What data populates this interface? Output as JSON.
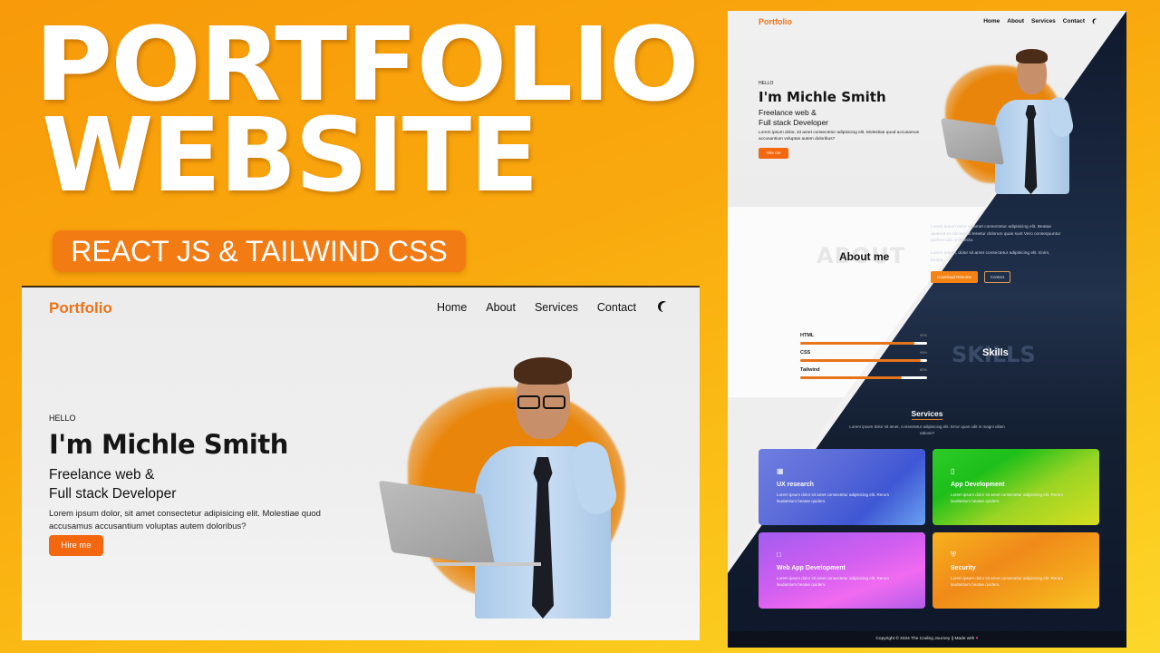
{
  "headline": {
    "line1": "PORTFOLIO",
    "line2": "WEBSITE"
  },
  "badge": "REACT JS & TAILWIND CSS",
  "colors": {
    "accent": "#f3680f",
    "brand": "#ec7319",
    "dark": "#0f172a",
    "background": "#f9a90d"
  },
  "site": {
    "logo": "Portfolio",
    "nav": [
      "Home",
      "About",
      "Services",
      "Contact"
    ],
    "theme_icon": "moon-icon",
    "hero": {
      "greeting": "HELLO",
      "name": "I'm Michle Smith",
      "role_line1": "Freelance web &",
      "role_line2": "Full stack Developer",
      "description": "Lorem ipsum dolor, sit amet consectetur adipisicing elit. Molestiae quod accusamus accusantium voluptas autem doloribus?",
      "cta": "Hire me"
    },
    "about": {
      "bg_word": "ABOUT",
      "title": "About me",
      "paragraph1": "Lorem ipsum dolor sit amet consectetur adipisicing elit. Beatae quaerat ex obcaecati tenetur dolorum quas sunt Vero consequuntur perferendis architecto.",
      "paragraph2": "Lorem ipsum, dolor sit amet consectetur adipisicing elit. Enim, beatae.",
      "download_label": "Download Resume",
      "contact_label": "Contact"
    },
    "skills": {
      "bg_word": "SKILLS",
      "title": "Skills",
      "items": [
        {
          "name": "HTML",
          "percent": 90
        },
        {
          "name": "CSS",
          "percent": 95
        },
        {
          "name": "Tailwind",
          "percent": 80
        }
      ]
    },
    "services": {
      "title": "Services",
      "description": "Lorem ipsum dolor sit amet, consectetur adipisicing elit. Error quas odit in magni ullam ratione?",
      "items": [
        {
          "icon": "layout-icon",
          "title": "UX research",
          "text": "Lorem ipsum dolor sit amet consectetur adipisicing elit. Rerum laudantium beatae quidem."
        },
        {
          "icon": "mobile-icon",
          "title": "App Development",
          "text": "Lorem ipsum dolor sit amet consectetur adipisicing elit. Rerum laudantium beatae quidem."
        },
        {
          "icon": "desktop-icon",
          "title": "Web App Development",
          "text": "Lorem ipsum dolor sit amet consectetur adipisicing elit. Rerum laudantium beatae quidem."
        },
        {
          "icon": "shield-icon",
          "title": "Security",
          "text": "Lorem ipsum dolor sit amet consectetur adipisicing elit. Rerum laudantium beatae quidem."
        }
      ]
    },
    "footer": {
      "text": "Copyright © 2024 The Coding Journey || Made with",
      "heart": "♥"
    }
  }
}
